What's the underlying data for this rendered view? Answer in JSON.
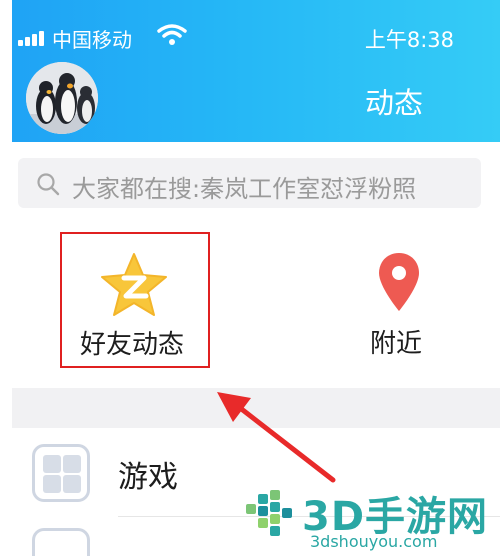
{
  "status_bar": {
    "carrier": "中国移动",
    "time": "上午8:38"
  },
  "header": {
    "title": "动态",
    "avatar": "penguin-avatar"
  },
  "search": {
    "placeholder": "大家都在搜:秦岚工作室怼浮粉照"
  },
  "grid": [
    {
      "label": "好友动态",
      "icon": "star-icon",
      "highlighted": true
    },
    {
      "label": "附近",
      "icon": "location-pin-icon",
      "highlighted": false
    }
  ],
  "list": [
    {
      "label": "游戏",
      "icon": "grid-icon"
    }
  ],
  "watermark": {
    "brand": "3D手游网",
    "url": "3dshouyou.com"
  },
  "colors": {
    "header_start": "#1fa3f5",
    "header_end": "#35ccf6",
    "highlight_border": "#e02020",
    "star_yellow": "#f8c63a",
    "pin_red": "#ee5a52",
    "watermark": "#2aa7a4"
  }
}
